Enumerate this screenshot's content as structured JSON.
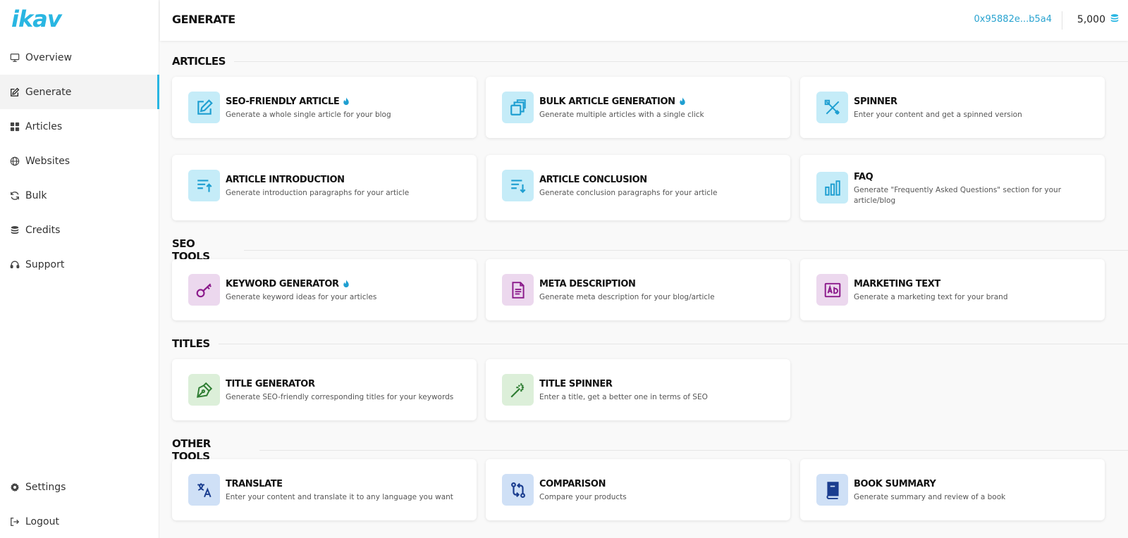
{
  "app": {
    "logo": "ikav"
  },
  "sidebar": {
    "items": [
      {
        "label": "Overview",
        "icon": "monitor-icon"
      },
      {
        "label": "Generate",
        "icon": "edit-icon",
        "active": true
      },
      {
        "label": "Articles",
        "icon": "grid-icon"
      },
      {
        "label": "Websites",
        "icon": "globe-icon"
      },
      {
        "label": "Bulk",
        "icon": "refresh-icon"
      },
      {
        "label": "Credits",
        "icon": "coins-icon"
      },
      {
        "label": "Support",
        "icon": "headset-icon"
      }
    ],
    "bottom": [
      {
        "label": "Settings",
        "icon": "gear-icon"
      },
      {
        "label": "Logout",
        "icon": "logout-icon"
      }
    ]
  },
  "header": {
    "title": "GENERATE",
    "wallet": "0x95882e...b5a4",
    "credits": "5,000"
  },
  "sections": {
    "articles": {
      "title": "ARTICLES",
      "cards": [
        {
          "title": "SEO-FRIENDLY ARTICLE",
          "desc": "Generate a whole single article for your blog",
          "icon": "edit-icon",
          "hot": true
        },
        {
          "title": "BULK ARTICLE GENERATION",
          "desc": "Generate multiple articles with a single click",
          "icon": "copy-icon",
          "hot": true
        },
        {
          "title": "SPINNER",
          "desc": "Enter your content and get a spinned version",
          "icon": "ruler-pencil-icon"
        },
        {
          "title": "ARTICLE INTRODUCTION",
          "desc": "Generate introduction paragraphs for your article",
          "icon": "sort-up-icon"
        },
        {
          "title": "ARTICLE CONCLUSION",
          "desc": "Generate conclusion paragraphs for your article",
          "icon": "sort-down-icon"
        },
        {
          "title": "FAQ",
          "desc": "Generate \"Frequently Asked Questions\" section for your article/blog",
          "icon": "bar-chart-icon"
        }
      ]
    },
    "seo": {
      "title": "SEO TOOLS",
      "cards": [
        {
          "title": "KEYWORD GENERATOR",
          "desc": "Generate keyword ideas for your articles",
          "icon": "key-icon",
          "hot": true
        },
        {
          "title": "META DESCRIPTION",
          "desc": "Generate meta description for your blog/article",
          "icon": "document-icon"
        },
        {
          "title": "MARKETING TEXT",
          "desc": "Generate a marketing text for your brand",
          "icon": "ad-icon"
        }
      ]
    },
    "titles": {
      "title": "TITLES",
      "cards": [
        {
          "title": "TITLE GENERATOR",
          "desc": "Generate SEO-friendly corresponding titles for your keywords",
          "icon": "pen-nib-icon"
        },
        {
          "title": "TITLE SPINNER",
          "desc": "Enter a title, get a better one in terms of SEO",
          "icon": "magic-wand-icon"
        }
      ]
    },
    "other": {
      "title": "OTHER TOOLS",
      "cards": [
        {
          "title": "TRANSLATE",
          "desc": "Enter your content and translate it to any language you want",
          "icon": "translate-icon"
        },
        {
          "title": "COMPARISON",
          "desc": "Compare your products",
          "icon": "compare-icon"
        },
        {
          "title": "BOOK SUMMARY",
          "desc": "Generate summary and review of a book",
          "icon": "book-icon"
        }
      ]
    }
  },
  "colors": {
    "accent": "#29b6e2",
    "blue_icon": "#1f9fd1",
    "purple_icon": "#8b1a8b",
    "green_icon": "#2e7d32",
    "navy_icon": "#1a3d8f"
  }
}
